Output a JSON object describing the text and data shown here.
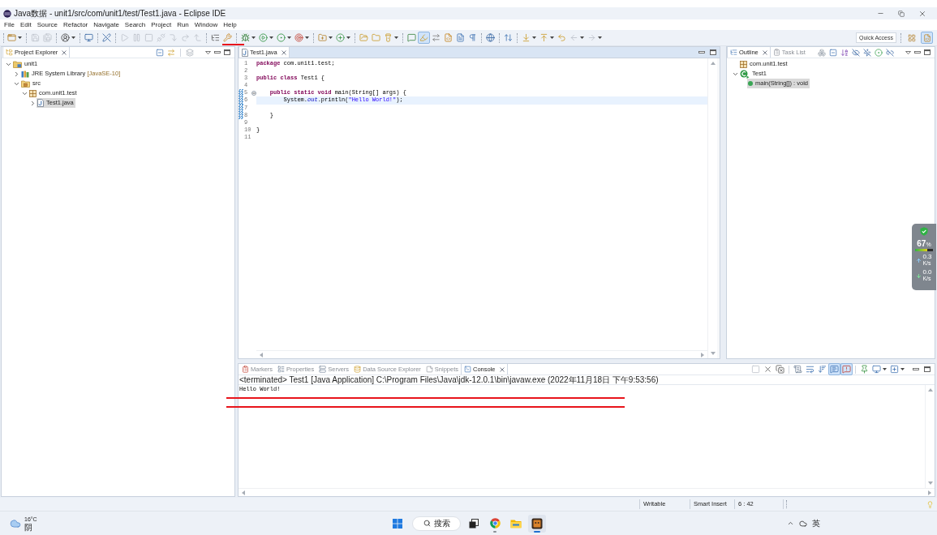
{
  "window": {
    "title": "Java数据 - unit1/src/com/unit1/test/Test1.java - Eclipse IDE"
  },
  "menu": [
    "File",
    "Edit",
    "Source",
    "Refactor",
    "Navigate",
    "Search",
    "Project",
    "Run",
    "Window",
    "Help"
  ],
  "toolbar": {
    "groups": [
      [
        {
          "disabled": false,
          "toggled": false,
          "dropdown": true
        }
      ],
      [
        {
          "disabled": true,
          "toggled": false,
          "dropdown": false
        },
        {
          "disabled": true,
          "toggled": false,
          "dropdown": false
        }
      ],
      [
        {
          "disabled": false,
          "toggled": false,
          "dropdown": true
        }
      ],
      [
        {
          "disabled": false,
          "toggled": false,
          "dropdown": false
        }
      ],
      [
        {
          "disabled": false,
          "toggled": false,
          "dropdown": false
        }
      ],
      [
        {
          "disabled": true,
          "toggled": false,
          "dropdown": false
        },
        {
          "disabled": true,
          "toggled": false,
          "dropdown": false
        },
        {
          "disabled": true,
          "toggled": false,
          "dropdown": false
        },
        {
          "disabled": true,
          "toggled": false,
          "dropdown": false
        },
        {
          "disabled": true,
          "toggled": false,
          "dropdown": false
        },
        {
          "disabled": true,
          "toggled": false,
          "dropdown": false
        },
        {
          "disabled": true,
          "toggled": false,
          "dropdown": false
        }
      ],
      [
        {
          "disabled": false,
          "toggled": false,
          "dropdown": false
        },
        {
          "disabled": false,
          "toggled": false,
          "dropdown": false
        }
      ],
      [
        {
          "disabled": false,
          "toggled": false,
          "dropdown": true
        },
        {
          "disabled": false,
          "toggled": false,
          "dropdown": true
        },
        {
          "disabled": false,
          "toggled": false,
          "dropdown": true
        },
        {
          "disabled": false,
          "toggled": false,
          "dropdown": true
        }
      ],
      [
        {
          "disabled": false,
          "toggled": false,
          "dropdown": true
        },
        {
          "disabled": false,
          "toggled": false,
          "dropdown": true
        }
      ],
      [
        {
          "disabled": false,
          "toggled": false,
          "dropdown": false
        },
        {
          "disabled": false,
          "toggled": false,
          "dropdown": false
        },
        {
          "disabled": false,
          "toggled": false,
          "dropdown": true
        }
      ],
      [
        {
          "disabled": false,
          "toggled": false,
          "dropdown": false
        },
        {
          "disabled": false,
          "toggled": true,
          "dropdown": false
        },
        {
          "disabled": false,
          "toggled": false,
          "dropdown": false
        },
        {
          "disabled": false,
          "toggled": false,
          "dropdown": false
        },
        {
          "disabled": false,
          "toggled": false,
          "dropdown": false
        },
        {
          "disabled": false,
          "toggled": false,
          "dropdown": false
        }
      ],
      [
        {
          "disabled": false,
          "toggled": false,
          "dropdown": false
        }
      ],
      [
        {
          "disabled": false,
          "toggled": false,
          "dropdown": false
        }
      ],
      [
        {
          "disabled": false,
          "toggled": false,
          "dropdown": true
        },
        {
          "disabled": false,
          "toggled": false,
          "dropdown": true
        },
        {
          "disabled": false,
          "toggled": false,
          "dropdown": false
        },
        {
          "disabled": true,
          "toggled": false,
          "dropdown": true
        },
        {
          "disabled": true,
          "toggled": false,
          "dropdown": true
        }
      ]
    ],
    "quick_access": {
      "placeholder": "Quick Access"
    },
    "perspectives": [
      {
        "selected": false
      },
      {
        "selected": true
      }
    ]
  },
  "project_explorer": {
    "tabs": [
      {
        "label": "Project Explorer",
        "selected": true
      }
    ],
    "tree": [
      {
        "label": "unit1",
        "kind": "project",
        "expanded": true,
        "selected": false,
        "children": [
          {
            "label": "JRE System Library",
            "suffix": "[JavaSE-10]",
            "kind": "library",
            "expanded": false,
            "selected": false
          },
          {
            "label": "src",
            "kind": "source-folder",
            "expanded": true,
            "selected": false,
            "children": [
              {
                "label": "com.unit1.test",
                "kind": "package",
                "expanded": true,
                "selected": false,
                "children": [
                  {
                    "label": "Test1.java",
                    "kind": "java-file",
                    "expanded": false,
                    "selected": true
                  }
                ]
              }
            ]
          }
        ]
      }
    ]
  },
  "editor": {
    "tabs": [
      {
        "label": "Test1.java",
        "selected": true
      }
    ],
    "lines": [
      {
        "number": "1",
        "changed": false,
        "foldable": false,
        "current": false,
        "tokens": [
          {
            "text": "package",
            "kind": "keyword"
          },
          {
            "text": " com.unit1.test;",
            "kind": "plain"
          }
        ]
      },
      {
        "number": "2",
        "changed": false,
        "foldable": false,
        "current": false
      },
      {
        "number": "3",
        "changed": false,
        "foldable": false,
        "current": false,
        "tokens": [
          {
            "text": "public",
            "kind": "keyword"
          },
          {
            "text": " class",
            "kind": "keyword"
          },
          {
            "text": " Test1 {",
            "kind": "plain"
          }
        ]
      },
      {
        "number": "4",
        "changed": false,
        "foldable": false,
        "current": false
      },
      {
        "number": "5",
        "changed": true,
        "foldable": true,
        "current": false,
        "tokens": [
          {
            "text": "    public",
            "kind": "keyword"
          },
          {
            "text": " static",
            "kind": "keyword"
          },
          {
            "text": " void",
            "kind": "keyword"
          },
          {
            "text": " main(String[] args) {",
            "kind": "plain"
          }
        ]
      },
      {
        "number": "6",
        "changed": true,
        "foldable": false,
        "current": true,
        "tokens": [
          {
            "text": "        System.",
            "kind": "plain"
          },
          {
            "text": "out",
            "kind": "field"
          },
          {
            "text": ".println(",
            "kind": "plain"
          },
          {
            "text": "\"Hello World!\"",
            "kind": "string"
          },
          {
            "text": ");",
            "kind": "plain"
          }
        ]
      },
      {
        "number": "7",
        "changed": true,
        "foldable": false,
        "current": false
      },
      {
        "number": "8",
        "changed": true,
        "foldable": false,
        "current": false,
        "tokens": [
          {
            "text": "    }",
            "kind": "plain"
          }
        ]
      },
      {
        "number": "9",
        "changed": false,
        "foldable": false,
        "current": false
      },
      {
        "number": "10",
        "changed": false,
        "foldable": false,
        "current": false,
        "tokens": [
          {
            "text": "}",
            "kind": "plain"
          }
        ]
      },
      {
        "number": "11",
        "changed": false,
        "foldable": false,
        "current": false
      }
    ]
  },
  "outline": {
    "tabs": [
      {
        "label": "Outline",
        "selected": true
      },
      {
        "label": "Task List",
        "selected": false
      }
    ],
    "tree": [
      {
        "label": "com.unit1.test",
        "kind": "package",
        "selected": false
      },
      {
        "label": "Test1",
        "kind": "class",
        "expanded": true,
        "selected": false,
        "children": [
          {
            "label": "main(String[]) : void",
            "kind": "method",
            "selected": true
          }
        ]
      }
    ]
  },
  "console": {
    "tabs": [
      {
        "label": "Markers",
        "selected": false
      },
      {
        "label": "Properties",
        "selected": false
      },
      {
        "label": "Servers",
        "selected": false
      },
      {
        "label": "Data Source Explorer",
        "selected": false
      },
      {
        "label": "Snippets",
        "selected": false
      },
      {
        "label": "Console",
        "selected": true
      }
    ],
    "toolbar": {
      "groups": [
        [
          {
            "disabled": true,
            "toggled": false,
            "dropdown": false
          },
          {
            "disabled": false,
            "toggled": false,
            "dropdown": false
          },
          {
            "disabled": false,
            "toggled": false,
            "dropdown": false
          }
        ],
        [
          {
            "disabled": false,
            "toggled": false,
            "dropdown": false
          },
          {
            "disabled": false,
            "toggled": false,
            "dropdown": false
          },
          {
            "disabled": false,
            "toggled": false,
            "dropdown": false
          },
          {
            "disabled": false,
            "toggled": true,
            "dropdown": false
          },
          {
            "disabled": false,
            "toggled": true,
            "dropdown": false
          }
        ],
        [
          {
            "disabled": false,
            "toggled": false,
            "dropdown": false
          },
          {
            "disabled": false,
            "toggled": false,
            "dropdown": true
          },
          {
            "disabled": false,
            "toggled": false,
            "dropdown": true
          }
        ]
      ]
    },
    "process": "<terminated> Test1 [Java Application] C:\\Program Files\\Java\\jdk-12.0.1\\bin\\javaw.exe (2022年11月18日 下午9:53:56)",
    "output": [
      "Hello World!"
    ]
  },
  "status_bar": [
    "Writable",
    "Smart Insert",
    "6 : 42"
  ],
  "taskbar": {
    "weather": {
      "temperature": "16°C",
      "condition": "阴"
    },
    "search": {
      "label": "搜索"
    },
    "apps": [
      {
        "running": false,
        "selected": false
      },
      {
        "running": true,
        "selected": false
      },
      {
        "running": false,
        "selected": false
      },
      {
        "running": true,
        "selected": true
      }
    ],
    "input_method": "英"
  },
  "system_monitor": {
    "percent": "67",
    "percent_unit": "%",
    "level": 0.67,
    "upload": {
      "rate": "0.3",
      "unit": "K/s"
    },
    "download": {
      "rate": "0.0",
      "unit": "K/s"
    }
  }
}
